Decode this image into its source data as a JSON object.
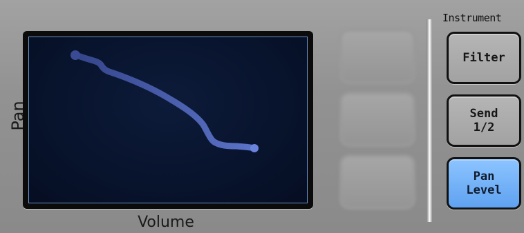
{
  "xy_pad": {
    "x_axis_label": "Volume",
    "y_axis_label": "Pan",
    "trace_color": "#4e63b6",
    "background_color": "#07122a"
  },
  "disabled_group": {
    "title": "",
    "buttons": [
      "",
      "",
      ""
    ]
  },
  "instrument": {
    "title": "Instrument",
    "buttons": [
      {
        "label": "Filter",
        "active": false
      },
      {
        "label": "Send\n1/2",
        "active": false
      },
      {
        "label": "Pan\nLevel",
        "active": true
      }
    ],
    "active_color": "#6aaaf5"
  }
}
